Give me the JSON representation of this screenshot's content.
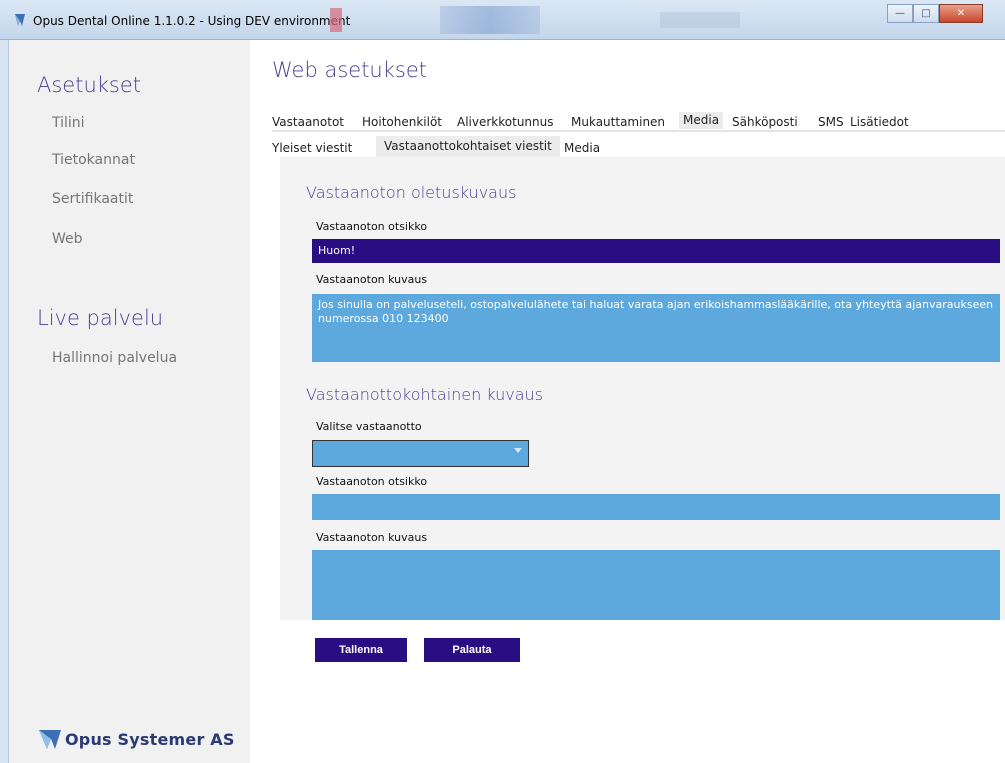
{
  "window": {
    "title": "Opus Dental Online 1.1.0.2 - Using DEV environment"
  },
  "sidebar": {
    "settings_title": "Asetukset",
    "items": [
      {
        "label": "Tilini"
      },
      {
        "label": "Tietokannat"
      },
      {
        "label": "Sertifikaatit"
      },
      {
        "label": "Web"
      }
    ],
    "live_title": "Live palvelu",
    "live_items": [
      {
        "label": "Hallinnoi palvelua"
      }
    ],
    "logo_text": "Opus Systemer AS"
  },
  "main": {
    "title": "Web asetukset",
    "tabs": [
      {
        "label": "Vastaanotot"
      },
      {
        "label": "Hoitohenkilöt"
      },
      {
        "label": "Aliverkkotunnus"
      },
      {
        "label": "Mukauttaminen"
      },
      {
        "label": "Media",
        "active": true
      },
      {
        "label": "Sähköposti"
      },
      {
        "label": "SMS"
      },
      {
        "label": "Lisätiedot"
      }
    ],
    "subtabs": [
      {
        "label": "Yleiset viestit"
      },
      {
        "label": "Vastaanottokohtaiset viestit",
        "active": true
      },
      {
        "label": "Media"
      }
    ],
    "default_section": {
      "heading": "Vastaanoton oletuskuvaus",
      "title_label": "Vastaanoton otsikko",
      "title_value": "Huom!",
      "desc_label": "Vastaanoton kuvaus",
      "desc_value": "Jos sinulla on palveluseteli, ostopalvelulähete tai haluat varata ajan erikoishammaslääkärille, ota yhteyttä ajanvaraukseen numerossa 010 123400"
    },
    "specific_section": {
      "heading": "Vastaanottokohtainen kuvaus",
      "select_label": "Valitse vastaanotto",
      "title_label": "Vastaanoton otsikko",
      "desc_label": "Vastaanoton kuvaus"
    },
    "buttons": {
      "save": "Tallenna",
      "reset": "Palauta"
    }
  },
  "colors": {
    "accent": "#4a3f8f",
    "field": "#5da9de",
    "field_active": "#2a0d82",
    "button": "#2a0d82"
  }
}
